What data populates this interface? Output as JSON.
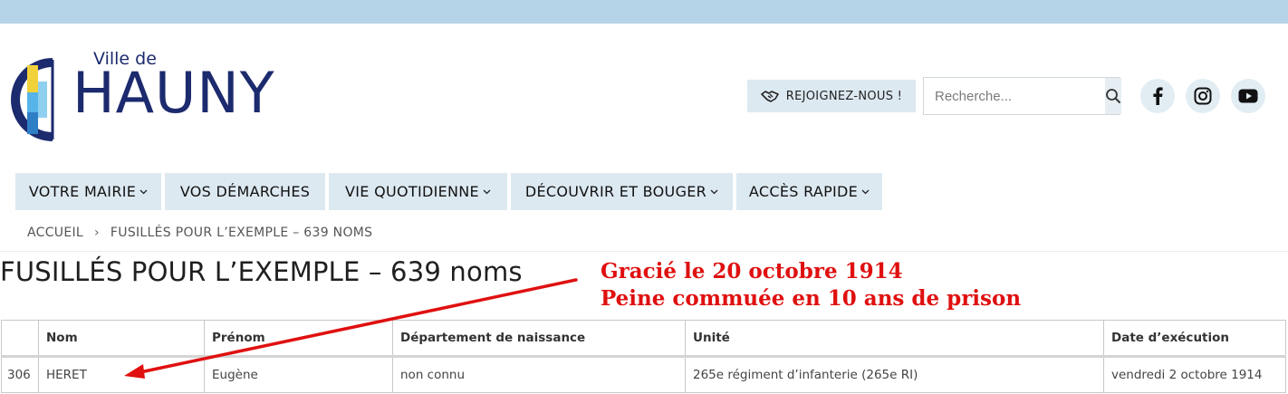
{
  "logo": {
    "ville": "Ville de",
    "word": "HAUNY"
  },
  "header": {
    "join_label": "REJOIGNEZ-NOUS !",
    "search_placeholder": "Recherche..."
  },
  "nav": [
    {
      "label": "VOTRE MAIRIE",
      "has_dropdown": true
    },
    {
      "label": "VOS DÉMARCHES",
      "has_dropdown": false
    },
    {
      "label": "VIE QUOTIDIENNE",
      "has_dropdown": true
    },
    {
      "label": "DÉCOUVRIR ET BOUGER",
      "has_dropdown": true
    },
    {
      "label": "ACCÈS RAPIDE",
      "has_dropdown": true
    }
  ],
  "breadcrumb": {
    "home": "ACCUEIL",
    "separator": "›",
    "current": "FUSILLÉS POUR L’EXEMPLE – 639 NOMS"
  },
  "page": {
    "title": "FUSILLÉS POUR L’EXEMPLE – 639 noms"
  },
  "annotation": {
    "line1": "Gracié le 20 octobre 1914",
    "line2": "Peine commuée en 10 ans de prison",
    "color": "#e01010"
  },
  "table": {
    "headers": [
      "",
      "Nom",
      "Prénom",
      "Département de naissance",
      "Unité",
      "Date d’exécution"
    ],
    "rows": [
      [
        "306",
        "HERET",
        "Eugène",
        "non connu",
        "265e régiment d’infanterie (265e RI)",
        "vendredi 2 octobre 1914"
      ]
    ]
  },
  "icons": {
    "join": "handshake-icon",
    "search": "search-icon",
    "social": [
      "facebook-icon",
      "instagram-icon",
      "youtube-icon"
    ]
  },
  "colors": {
    "topbar": "#b5d3e6",
    "nav_bg": "#dde9f1",
    "logo_blue": "#1c2a6e"
  }
}
